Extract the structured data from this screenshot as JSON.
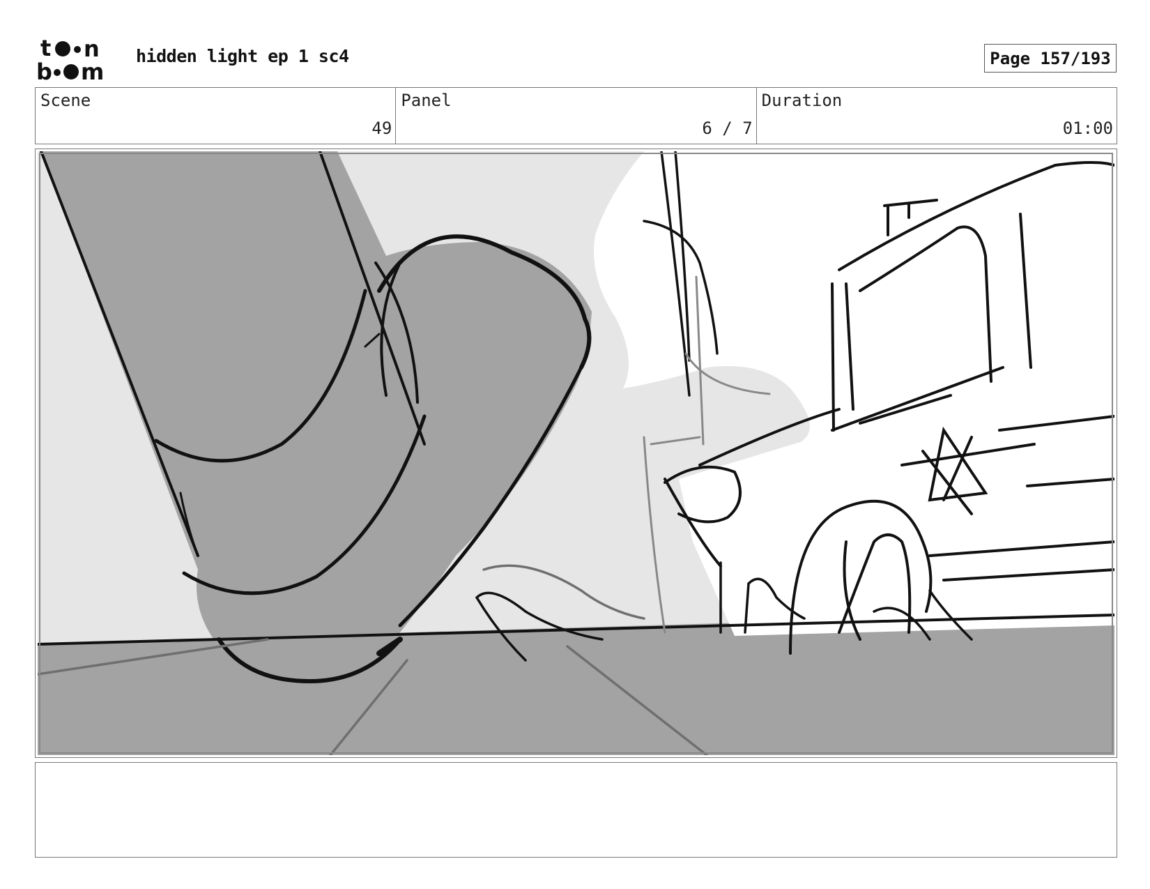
{
  "header": {
    "logo_text": "toon boom",
    "title": "hidden light ep 1 sc4",
    "page": "Page 157/193"
  },
  "info": {
    "scene_label": "Scene",
    "scene_value": "49",
    "panel_label": "Panel",
    "panel_value": "6 / 7",
    "duration_label": "Duration",
    "duration_value": "01:00"
  },
  "notes": {
    "text": ""
  }
}
